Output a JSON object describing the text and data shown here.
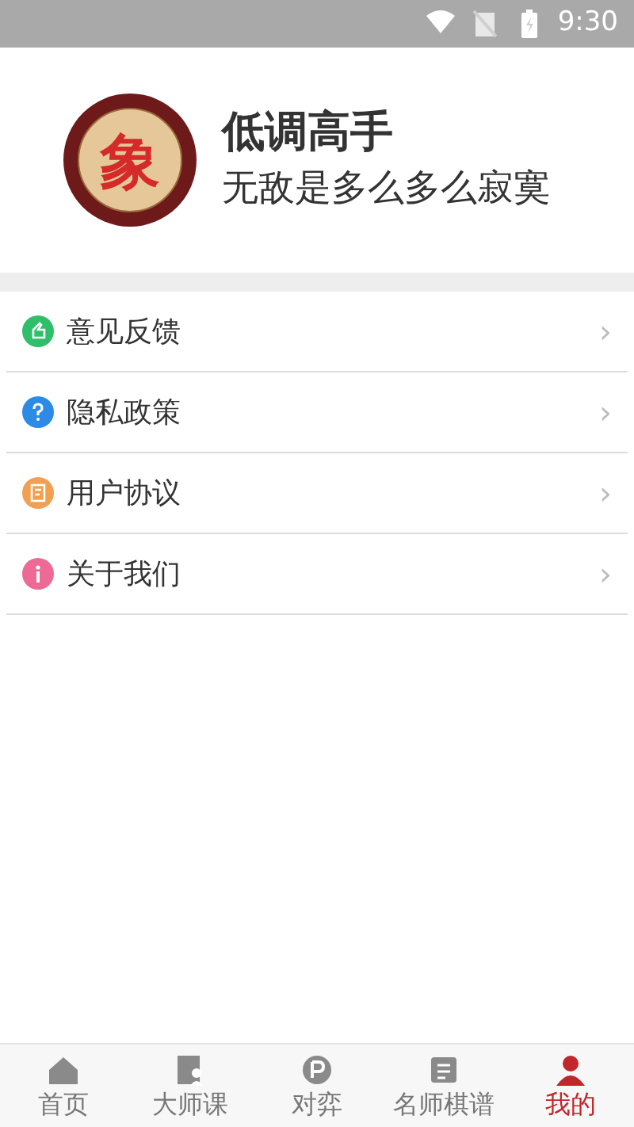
{
  "status_bar": {
    "time": "9:30"
  },
  "profile": {
    "avatar_char": "象",
    "name": "低调高手",
    "motto": "无敌是多么多么寂寞"
  },
  "menu": [
    {
      "label": "意见反馈",
      "color": "#2fbf6a"
    },
    {
      "label": "隐私政策",
      "color": "#2b8be6"
    },
    {
      "label": "用户协议",
      "color": "#f0a050"
    },
    {
      "label": "关于我们",
      "color": "#ec6a95"
    }
  ],
  "chevron": "›",
  "tabs": [
    {
      "label": "首页",
      "selected": false
    },
    {
      "label": "大师课",
      "selected": false
    },
    {
      "label": "对弈",
      "selected": false
    },
    {
      "label": "名师棋谱",
      "selected": false
    },
    {
      "label": "我的",
      "selected": true
    }
  ]
}
